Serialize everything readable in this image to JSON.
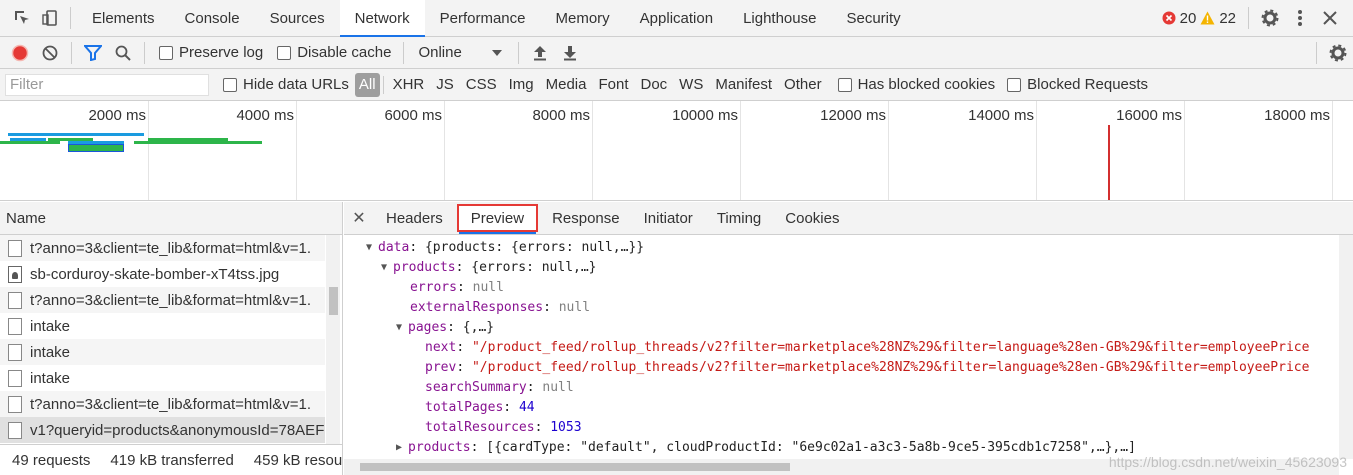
{
  "topbar": {
    "tabs": [
      "Elements",
      "Console",
      "Sources",
      "Network",
      "Performance",
      "Memory",
      "Application",
      "Lighthouse",
      "Security"
    ],
    "active_tab": "Network",
    "errors": "20",
    "warnings": "22"
  },
  "toolbar": {
    "preserve_log": "Preserve log",
    "disable_cache": "Disable cache",
    "throttle": "Online"
  },
  "filterbar": {
    "placeholder": "Filter",
    "hide_data_urls": "Hide data URLs",
    "types": [
      "All",
      "XHR",
      "JS",
      "CSS",
      "Img",
      "Media",
      "Font",
      "Doc",
      "WS",
      "Manifest",
      "Other"
    ],
    "has_blocked_cookies": "Has blocked cookies",
    "blocked_requests": "Blocked Requests"
  },
  "timeline": {
    "labels": [
      "2000 ms",
      "4000 ms",
      "6000 ms",
      "8000 ms",
      "10000 ms",
      "12000 ms",
      "14000 ms",
      "16000 ms",
      "18000 ms"
    ]
  },
  "requests": {
    "header": "Name",
    "rows": [
      {
        "name": "t?anno=3&client=te_lib&format=html&v=1.",
        "kind": "doc"
      },
      {
        "name": "sb-corduroy-skate-bomber-xT4tss.jpg",
        "kind": "img"
      },
      {
        "name": "t?anno=3&client=te_lib&format=html&v=1.",
        "kind": "doc"
      },
      {
        "name": "intake",
        "kind": "doc"
      },
      {
        "name": "intake",
        "kind": "doc"
      },
      {
        "name": "intake",
        "kind": "doc"
      },
      {
        "name": "t?anno=3&client=te_lib&format=html&v=1.",
        "kind": "doc"
      },
      {
        "name": "v1?queryid=products&anonymousId=78AEF",
        "kind": "doc"
      }
    ],
    "status": {
      "requests": "49 requests",
      "transferred": "419 kB transferred",
      "resources": "459 kB resou"
    }
  },
  "details": {
    "tabs": [
      "Headers",
      "Preview",
      "Response",
      "Initiator",
      "Timing",
      "Cookies"
    ],
    "active_tab": "Preview",
    "tree": {
      "l1_key": "data",
      "l1_val": "{products: {errors: null,…}}",
      "l2_key": "products",
      "l2_val": "{errors: null,…}",
      "errors_key": "errors",
      "errors_val": "null",
      "ext_key": "externalResponses",
      "ext_val": "null",
      "pages_key": "pages",
      "pages_val": "{,…}",
      "next_key": "next",
      "next_val": "\"/product_feed/rollup_threads/v2?filter=marketplace%28NZ%29&filter=language%28en-GB%29&filter=employeePrice",
      "prev_key": "prev",
      "prev_val": "\"/product_feed/rollup_threads/v2?filter=marketplace%28NZ%29&filter=language%28en-GB%29&filter=employeePrice",
      "summary_key": "searchSummary",
      "summary_val": "null",
      "tpages_key": "totalPages",
      "tpages_val": "44",
      "tres_key": "totalResources",
      "tres_val": "1053",
      "prods_key": "products",
      "prods_val": "[{cardType: \"default\", cloudProductId: \"6e9c02a1-a3c3-5a8b-9ce5-395cdb1c7258\",…},…]"
    }
  },
  "watermark": "https://blog.csdn.net/weixin_45623093"
}
